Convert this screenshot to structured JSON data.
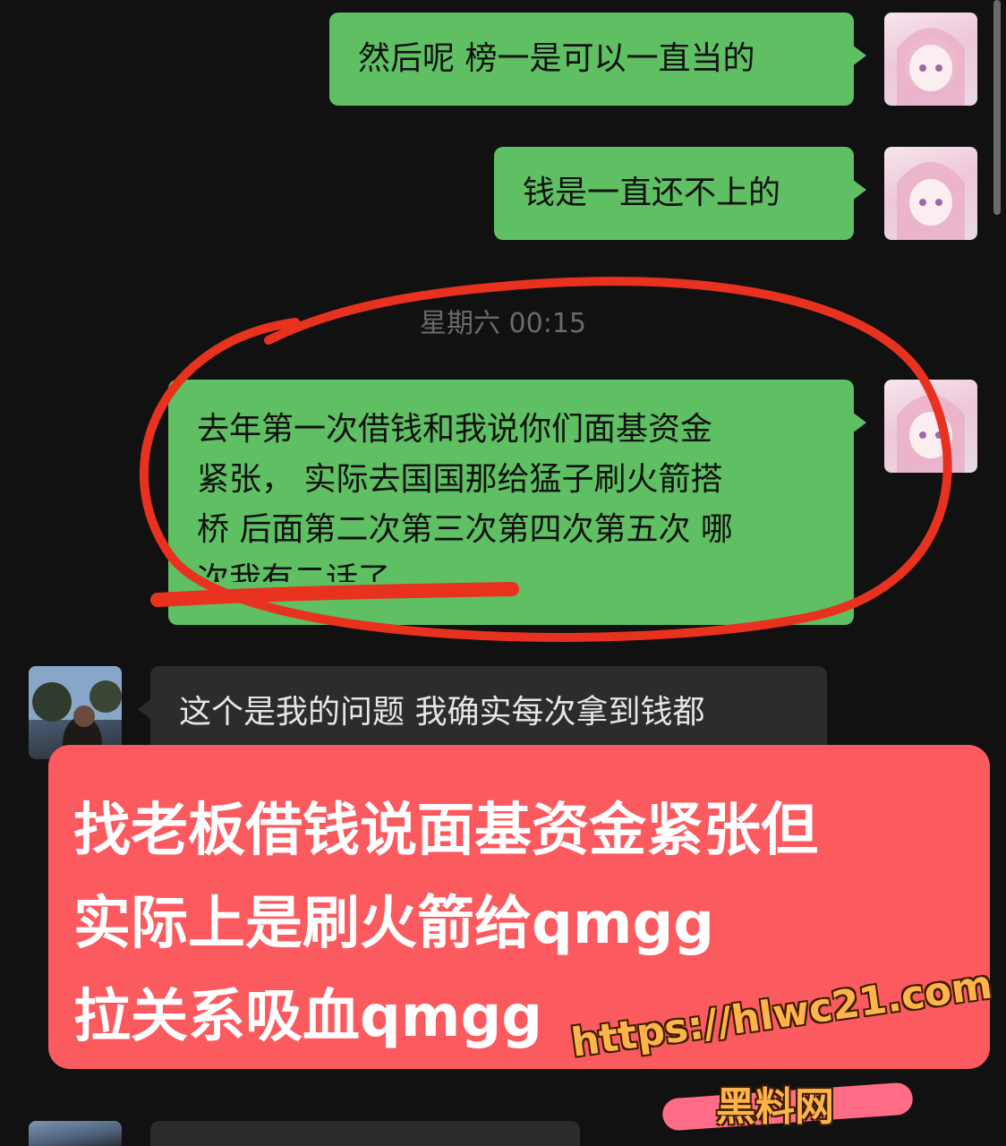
{
  "chat": {
    "messages": [
      {
        "direction": "outgoing",
        "text": "然后呢 榜一是可以一直当的"
      },
      {
        "direction": "outgoing",
        "text": "钱是一直还不上的"
      },
      {
        "direction": "outgoing",
        "lines": [
          "去年第一次借钱和我说你们面基资金",
          "紧张， 实际去国国那给猛子刷火箭搭",
          "桥 后面第二次第三次第四次第五次 哪",
          "次我有二话了"
        ]
      },
      {
        "direction": "incoming",
        "text": "这个是我的问题 我确实每次拿到钱都"
      }
    ],
    "timestamp": "星期六 00:15"
  },
  "overlay": {
    "lines": [
      "找老板借钱说面基资金紧张但",
      "实际上是刷火箭给qmgg",
      "拉关系吸血qmgg"
    ],
    "color": "#fb5a5f"
  },
  "watermark": {
    "url": "https://hlwc21.com",
    "name": "黑料网"
  },
  "colors": {
    "background": "#111111",
    "outgoing_bubble": "#5fbf63",
    "incoming_bubble": "#2c2c2c",
    "annotation": "#e8321f"
  },
  "icons": {
    "outgoing_avatar": "anime-girl-avatar",
    "incoming_avatar": "photo-avatar"
  }
}
